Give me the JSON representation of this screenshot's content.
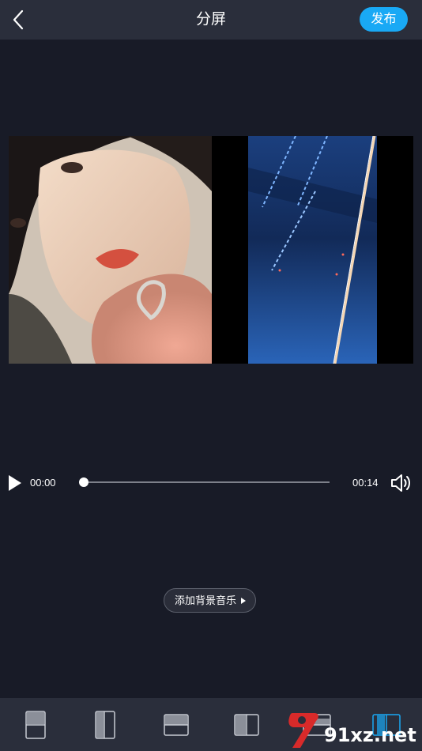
{
  "header": {
    "title": "分屏",
    "publish_label": "发布"
  },
  "player": {
    "current_time": "00:00",
    "total_time": "00:14",
    "progress": 0
  },
  "music": {
    "label": "添加背景音乐"
  },
  "layouts": [
    {
      "name": "layout-top-bottom",
      "selected": false
    },
    {
      "name": "layout-side-by-side",
      "selected": false
    },
    {
      "name": "layout-horizontal-split",
      "selected": false
    },
    {
      "name": "layout-vertical-split",
      "selected": false
    },
    {
      "name": "layout-framed-horizontal",
      "selected": false
    },
    {
      "name": "layout-framed-side",
      "selected": true
    }
  ],
  "watermark": {
    "text": "91xz.net"
  },
  "colors": {
    "accent": "#19a9f5",
    "background": "#181b27",
    "bar": "#2a2e3b"
  }
}
